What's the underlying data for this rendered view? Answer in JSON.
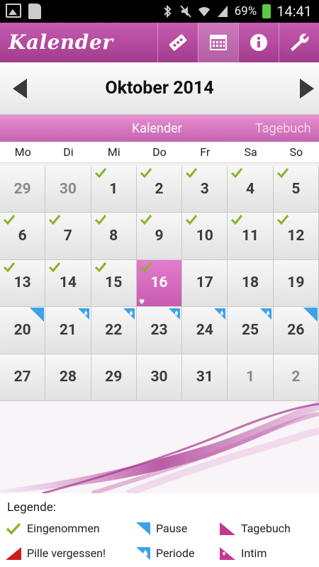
{
  "statusbar": {
    "battery": "69%",
    "time": "14:41"
  },
  "appbar": {
    "title": "Kalender",
    "buttons": [
      {
        "name": "pill-icon"
      },
      {
        "name": "calendar-icon"
      },
      {
        "name": "info-icon"
      },
      {
        "name": "wrench-icon"
      }
    ]
  },
  "month_nav": {
    "title": "Oktober 2014"
  },
  "tabs": {
    "kalender": "Kalender",
    "tagebuch": "Tagebuch"
  },
  "weekdays": [
    "Mo",
    "Di",
    "Mi",
    "Do",
    "Fr",
    "Sa",
    "So"
  ],
  "calendar": {
    "days": [
      {
        "n": "29",
        "other": true
      },
      {
        "n": "30",
        "other": true
      },
      {
        "n": "1",
        "check": true
      },
      {
        "n": "2",
        "check": true
      },
      {
        "n": "3",
        "check": true
      },
      {
        "n": "4",
        "check": true
      },
      {
        "n": "5",
        "check": true
      },
      {
        "n": "6",
        "check": true
      },
      {
        "n": "7",
        "check": true
      },
      {
        "n": "8",
        "check": true
      },
      {
        "n": "9",
        "check": true
      },
      {
        "n": "10",
        "check": true
      },
      {
        "n": "11",
        "check": true
      },
      {
        "n": "12",
        "check": true
      },
      {
        "n": "13",
        "check": true
      },
      {
        "n": "14",
        "check": true
      },
      {
        "n": "15",
        "check": true
      },
      {
        "n": "16",
        "check": true,
        "today": true,
        "intim": true
      },
      {
        "n": "17"
      },
      {
        "n": "18"
      },
      {
        "n": "19"
      },
      {
        "n": "20",
        "pause": true
      },
      {
        "n": "21",
        "period": true
      },
      {
        "n": "22",
        "period": true
      },
      {
        "n": "23",
        "period": true
      },
      {
        "n": "24",
        "period": true
      },
      {
        "n": "25",
        "period": true
      },
      {
        "n": "26",
        "pause": true
      },
      {
        "n": "27"
      },
      {
        "n": "28"
      },
      {
        "n": "29"
      },
      {
        "n": "30"
      },
      {
        "n": "31"
      },
      {
        "n": "1",
        "other": true
      },
      {
        "n": "2",
        "other": true
      }
    ]
  },
  "legend": {
    "title": "Legende:",
    "items": {
      "eingenommen": "Eingenommen",
      "pause": "Pause",
      "tagebuch": "Tagebuch",
      "vergessen": "Pille vergessen!",
      "periode": "Periode",
      "intim": "Intim"
    }
  },
  "colors": {
    "accent": "#b84ba0",
    "check": "#8ab42a",
    "pause": "#3da3e8",
    "forgot": "#d01c1c"
  }
}
